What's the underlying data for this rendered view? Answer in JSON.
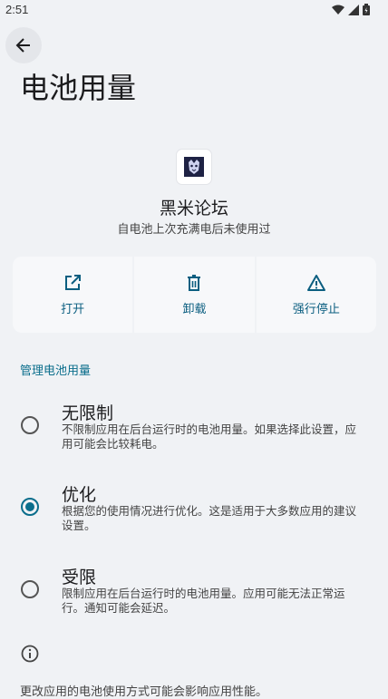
{
  "status_bar": {
    "time": "2:51"
  },
  "header": {
    "title": "电池用量"
  },
  "app": {
    "name": "黑米论坛",
    "subtitle": "自电池上次充满电后未使用过"
  },
  "actions": [
    {
      "label": "打开",
      "icon": "open-external-icon"
    },
    {
      "label": "卸载",
      "icon": "trash-icon"
    },
    {
      "label": "强行停止",
      "icon": "warning-icon"
    }
  ],
  "manage": {
    "header": "管理电池用量",
    "options": [
      {
        "title": "无限制",
        "description": "不限制应用在后台运行时的电池用量。如果选择此设置，应用可能会比较耗电。",
        "selected": false
      },
      {
        "title": "优化",
        "description": "根据您的使用情况进行优化。这是适用于大多数应用的建议设置。",
        "selected": true
      },
      {
        "title": "受限",
        "description": "限制应用在后台运行时的电池用量。应用可能无法正常运行。通知可能会延迟。",
        "selected": false
      }
    ]
  },
  "footer": {
    "text": "更改应用的电池使用方式可能会影响应用性能。"
  },
  "colors": {
    "accent": "#0b6e8c",
    "background": "#f0f2f5"
  }
}
